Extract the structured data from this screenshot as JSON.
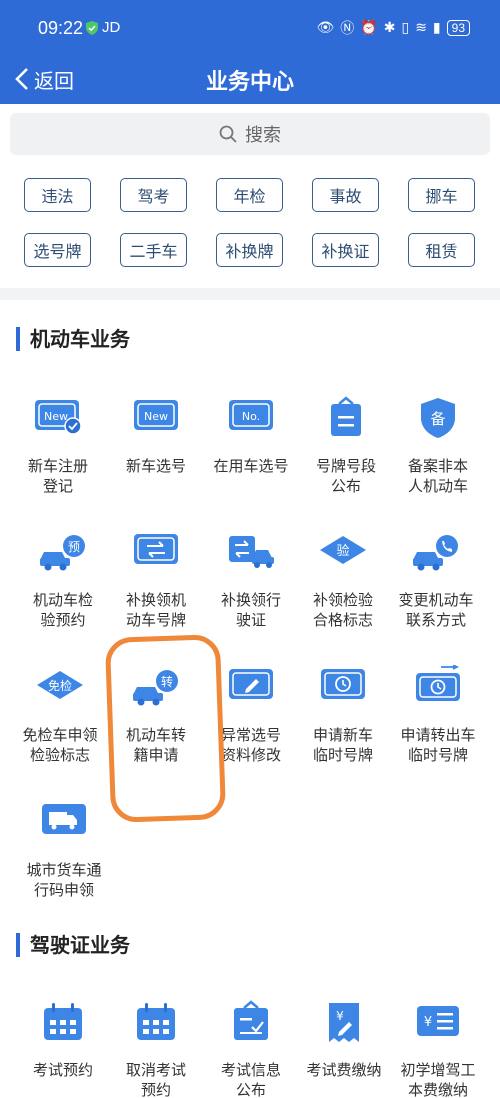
{
  "status_bar": {
    "time": "09:22",
    "carrier": "JD",
    "battery": "93"
  },
  "nav": {
    "back_label": "返回",
    "title": "业务中心"
  },
  "search": {
    "placeholder": "搜索"
  },
  "tags": [
    [
      "违法",
      "驾考",
      "年检",
      "事故",
      "挪车"
    ],
    [
      "选号牌",
      "二手车",
      "补换牌",
      "补换证",
      "租赁"
    ]
  ],
  "sections": [
    {
      "title": "机动车业务",
      "items": [
        {
          "label": "新车注册\n登记",
          "icon": "new-registration-icon"
        },
        {
          "label": "新车选号",
          "icon": "new-plate-icon"
        },
        {
          "label": "在用车选号",
          "icon": "number-plate-icon"
        },
        {
          "label": "号牌号段\n公布",
          "icon": "notice-board-icon"
        },
        {
          "label": "备案非本\n人机动车",
          "icon": "shield-record-icon"
        },
        {
          "label": "机动车检\n验预约",
          "icon": "car-appointment-icon"
        },
        {
          "label": "补换领机\n动车号牌",
          "icon": "plate-exchange-icon"
        },
        {
          "label": "补换领行\n驶证",
          "icon": "license-exchange-icon"
        },
        {
          "label": "补领检验\n合格标志",
          "icon": "inspection-mark-icon"
        },
        {
          "label": "变更机动车\n联系方式",
          "icon": "car-phone-icon"
        },
        {
          "label": "免检车申领\n检验标志",
          "icon": "exempt-mark-icon"
        },
        {
          "label": "机动车转\n籍申请",
          "icon": "car-transfer-icon"
        },
        {
          "label": "异常选号\n资料修改",
          "icon": "edit-plate-icon"
        },
        {
          "label": "申请新车\n临时号牌",
          "icon": "temp-plate-icon"
        },
        {
          "label": "申请转出车\n临时号牌",
          "icon": "transfer-temp-plate-icon"
        },
        {
          "label": "城市货车通\n行码申领",
          "icon": "truck-pass-icon"
        }
      ]
    },
    {
      "title": "驾驶证业务",
      "items": [
        {
          "label": "考试预约",
          "icon": "calendar-icon"
        },
        {
          "label": "取消考试\n预约",
          "icon": "calendar-cancel-icon"
        },
        {
          "label": "考试信息\n公布",
          "icon": "exam-notice-icon"
        },
        {
          "label": "考试费缴纳",
          "icon": "fee-receipt-icon"
        },
        {
          "label": "初学增驾工\n本费缴纳",
          "icon": "fee-card-icon"
        }
      ]
    }
  ],
  "icon_text": {
    "new": "New",
    "no": "No.",
    "bei": "备",
    "yu": "预",
    "yan": "验",
    "mianjian": "免检",
    "zhuan": "转"
  },
  "colors": {
    "primary": "#2f6bd6",
    "icon_blue": "#3d86e6",
    "annotation": "#f0883a"
  }
}
